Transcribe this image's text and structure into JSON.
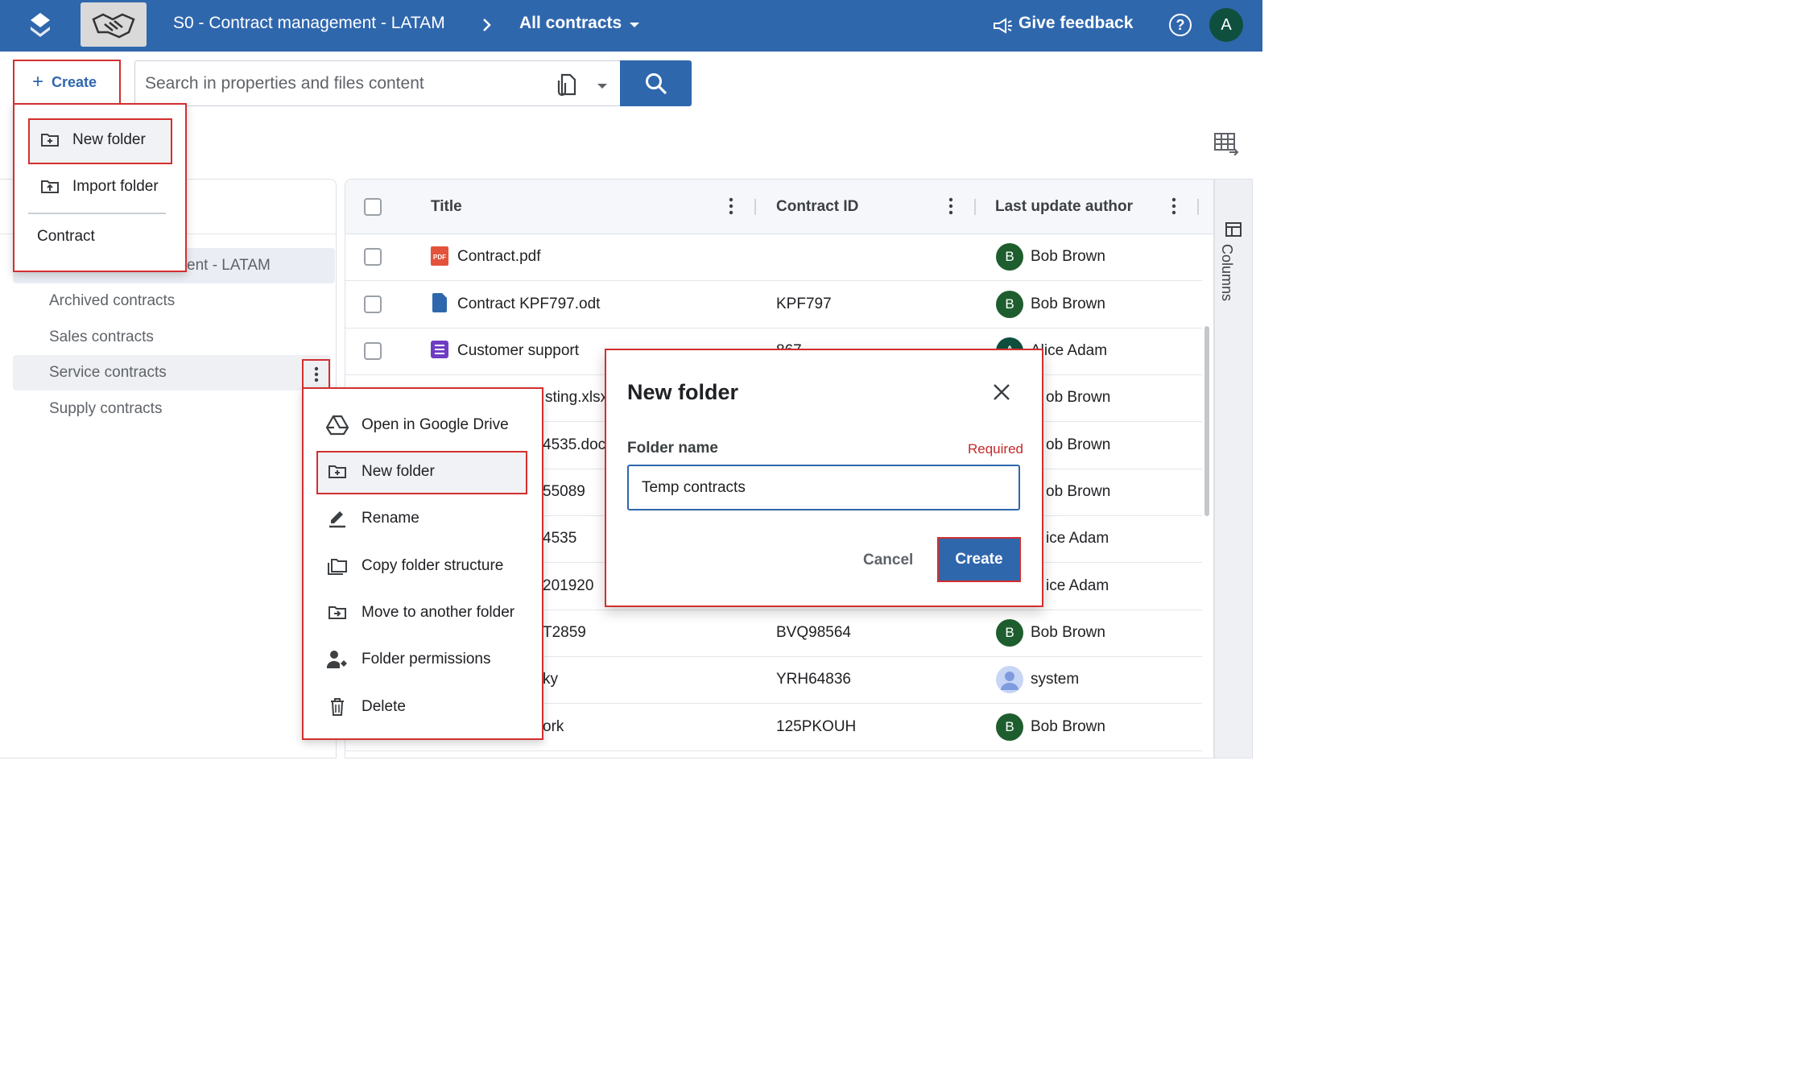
{
  "header": {
    "title": "S0 - Contract management - LATAM",
    "view": "All contracts",
    "feedback": "Give feedback",
    "help": "?",
    "avatar_initial": "A",
    "brand_color": "#2f67ad"
  },
  "toolbar": {
    "create_label": "Create",
    "search_placeholder": "Search in properties and files content"
  },
  "create_menu": {
    "new_folder": "New folder",
    "import_folder": "Import folder",
    "contract": "Contract"
  },
  "tree": {
    "root_partial": "ent - LATAM",
    "items": [
      "Archived contracts",
      "Sales contracts",
      "Service contracts",
      "Supply contracts"
    ]
  },
  "table": {
    "columns": [
      "Title",
      "Contract ID",
      "Last update author"
    ],
    "rows": [
      {
        "title": "Contract.pdf",
        "icon": "pdf-icon",
        "contract_id": "",
        "author": "Bob Brown",
        "initial": "B"
      },
      {
        "title": "Contract KPF797.odt",
        "icon": "doc-icon",
        "contract_id": "KPF797",
        "author": "Bob Brown",
        "initial": "B"
      },
      {
        "title": "Customer support",
        "icon": "form-icon",
        "contract_id": "867",
        "author": "Alice Adam",
        "initial": "A"
      },
      {
        "title": "sting.xlsx",
        "icon": "",
        "contract_id": "",
        "author": "ob Brown",
        "initial": ""
      },
      {
        "title": "4535.doc",
        "icon": "",
        "contract_id": "",
        "author": "ob Brown",
        "initial": ""
      },
      {
        "title": "55089",
        "icon": "",
        "contract_id": "",
        "author": "ob Brown",
        "initial": ""
      },
      {
        "title": "4535",
        "icon": "",
        "contract_id": "",
        "author": "ice Adam",
        "initial": ""
      },
      {
        "title": "201920",
        "icon": "",
        "contract_id": "",
        "author": "ice Adam",
        "initial": ""
      },
      {
        "title": "T2859",
        "icon": "",
        "contract_id": "BVQ98564",
        "author": "Bob Brown",
        "initial": "B"
      },
      {
        "title": "ky",
        "icon": "",
        "contract_id": "YRH64836",
        "author": "system",
        "initial": ""
      },
      {
        "title": "ork",
        "icon": "",
        "contract_id": "125PKOUH",
        "author": "Bob Brown",
        "initial": "B"
      }
    ]
  },
  "columns_tab": "Columns",
  "context_menu": {
    "items": [
      "Open in Google Drive",
      "New folder",
      "Rename",
      "Copy folder structure",
      "Move to another folder",
      "Folder permissions",
      "Delete"
    ]
  },
  "dialog": {
    "title": "New folder",
    "field_label": "Folder name",
    "required": "Required",
    "value": "Temp contracts",
    "cancel": "Cancel",
    "create": "Create"
  }
}
